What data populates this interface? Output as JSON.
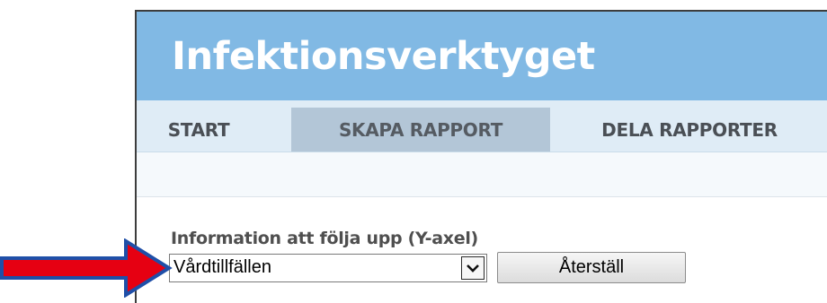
{
  "app": {
    "title": "Infektionsverktyget"
  },
  "nav": {
    "items": [
      {
        "label": "START",
        "active": false
      },
      {
        "label": "SKAPA RAPPORT",
        "active": true
      },
      {
        "label": "DELA RAPPORTER",
        "active": false
      }
    ]
  },
  "form": {
    "y_axis_label": "Information att följa upp (Y-axel)",
    "y_axis_value": "Vårdtillfällen",
    "reset_label": "Återställ"
  },
  "colors": {
    "banner": "#81b9e4",
    "nav_background": "#dfecf6",
    "nav_active": "#b3c6d7",
    "annotation_arrow_fill": "#e60012",
    "annotation_arrow_outline": "#1f4fa8"
  },
  "icons": {
    "dropdown": "chevron-down-icon",
    "annotation": "red-arrow-pointer"
  }
}
